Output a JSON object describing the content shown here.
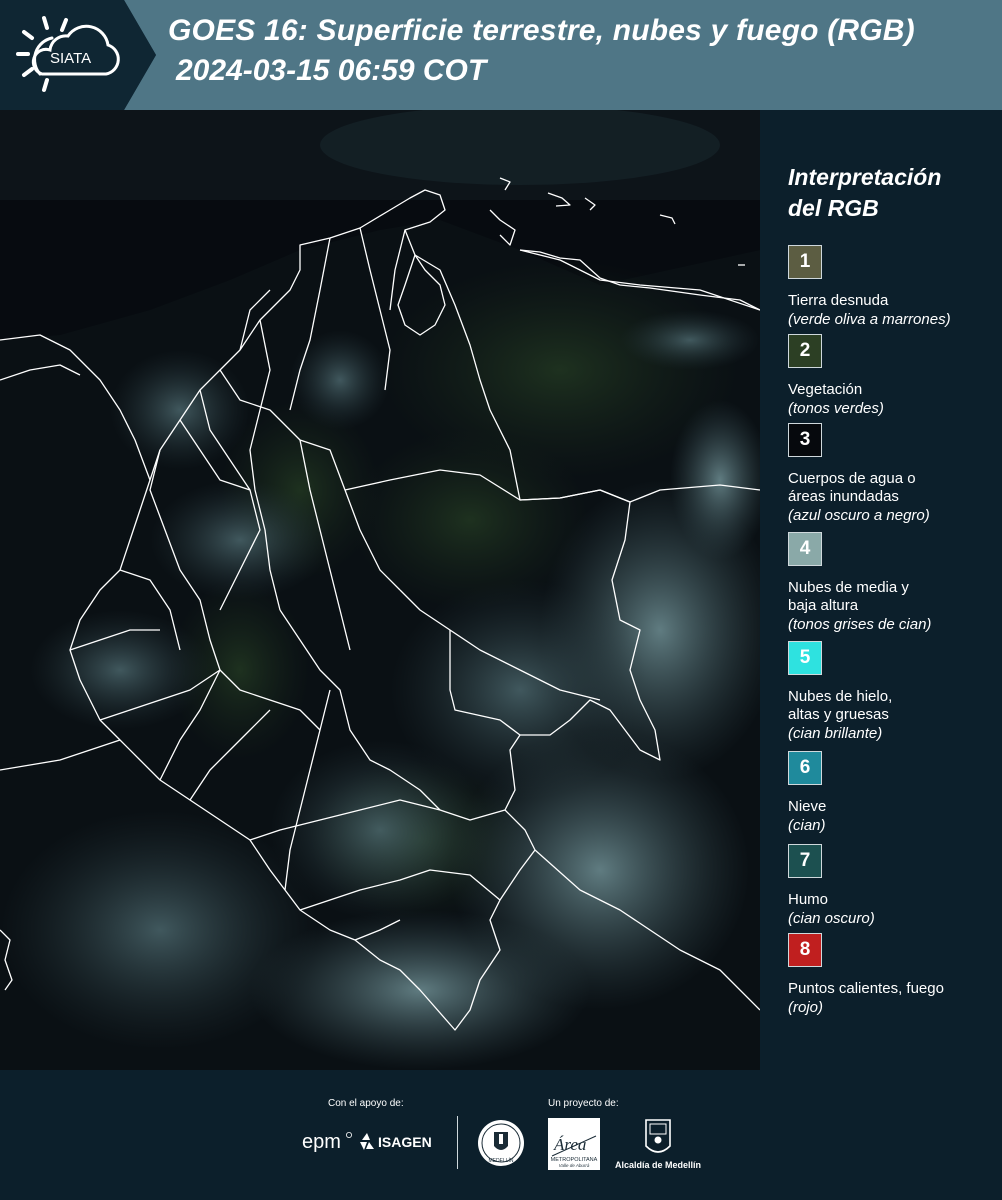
{
  "header": {
    "title_line1": "GOES 16: Superficie terrestre, nubes y fuego (RGB)",
    "title_line2": "2024-03-15 06:59 COT",
    "logo_text": "SIATA",
    "logo_icon": "sun-cloud-icon"
  },
  "legend": {
    "title_line1": "Interpretación",
    "title_line2": "del RGB",
    "items": [
      {
        "number": "1",
        "name": "Tierra desnuda",
        "desc": "(verde oliva a marrones)",
        "color": "#5c5d42"
      },
      {
        "number": "2",
        "name": "Vegetación",
        "desc": "(tonos verdes)",
        "color": "#2c3f24"
      },
      {
        "number": "3",
        "name": "Cuerpos de agua o áreas inundadas",
        "desc": "(azul oscuro a negro)",
        "color": "#06090d"
      },
      {
        "number": "4",
        "name": "Nubes de media y baja altura",
        "desc": "(tonos grises de cian)",
        "color": "#8aa9a8"
      },
      {
        "number": "5",
        "name": "Nubes de hielo, altas y gruesas",
        "desc": "(cian brillante)",
        "color": "#2ee2e0"
      },
      {
        "number": "6",
        "name": "Nieve",
        "desc": "(cian)",
        "color": "#1f8a9c"
      },
      {
        "number": "7",
        "name": "Humo",
        "desc": "(cian oscuro)",
        "color": "#1c5050"
      },
      {
        "number": "8",
        "name": "Puntos calientes, fuego",
        "desc": "(rojo)",
        "color": "#c01f1f"
      }
    ]
  },
  "footer": {
    "support_label": "Con el apoyo de:",
    "project_label": "Un proyecto de:",
    "logos": {
      "epm": "epm",
      "isagen": "ISAGEN",
      "gobernacion_seal": "MEDELLÍN",
      "area_metropolitana_word": "Área",
      "area_metropolitana_sub": "METROPOLITANA",
      "area_metropolitana_tag": "Valle de Aburrá",
      "alcaldia": "Alcaldía de Medellín"
    }
  }
}
